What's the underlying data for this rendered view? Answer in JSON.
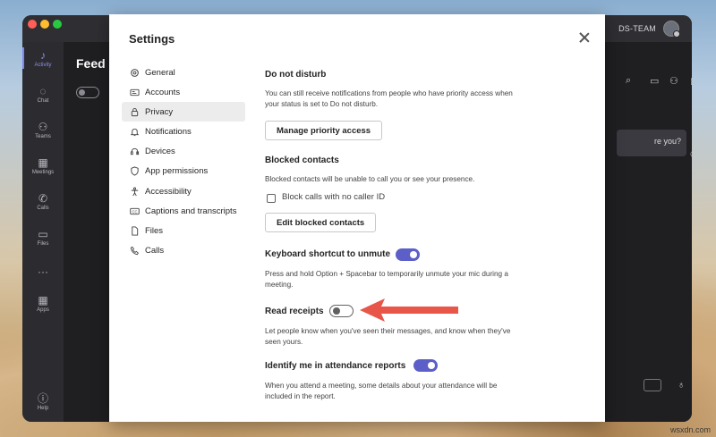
{
  "window": {
    "team_name": "DS-TEAM"
  },
  "rail": [
    {
      "label": "Activity",
      "icon": "bell-icon",
      "glyph": "🔔"
    },
    {
      "label": "Chat",
      "icon": "chat-icon",
      "glyph": "💬"
    },
    {
      "label": "Teams",
      "icon": "teams-icon",
      "glyph": "👥"
    },
    {
      "label": "Meetings",
      "icon": "calendar-icon",
      "glyph": "📅"
    },
    {
      "label": "Calls",
      "icon": "phone-icon",
      "glyph": "📞"
    },
    {
      "label": "Files",
      "icon": "file-icon",
      "glyph": "📄"
    },
    {
      "label": "",
      "icon": "more-icon",
      "glyph": "•••"
    },
    {
      "label": "Apps",
      "icon": "apps-icon",
      "glyph": "▦"
    },
    {
      "label": "Help",
      "icon": "help-icon",
      "glyph": "?"
    }
  ],
  "main": {
    "title": "Feed",
    "bubble_text": "re you?"
  },
  "settings": {
    "title": "Settings",
    "nav": [
      {
        "label": "General",
        "icon": "gear-icon"
      },
      {
        "label": "Accounts",
        "icon": "id-card-icon"
      },
      {
        "label": "Privacy",
        "icon": "lock-icon"
      },
      {
        "label": "Notifications",
        "icon": "bell-icon"
      },
      {
        "label": "Devices",
        "icon": "devices-icon"
      },
      {
        "label": "App permissions",
        "icon": "shield-icon"
      },
      {
        "label": "Accessibility",
        "icon": "accessibility-icon"
      },
      {
        "label": "Captions and transcripts",
        "icon": "cc-icon"
      },
      {
        "label": "Files",
        "icon": "file-icon"
      },
      {
        "label": "Calls",
        "icon": "phone-icon"
      }
    ],
    "selected_nav": "Privacy",
    "dnd": {
      "title": "Do not disturb",
      "text": "You can still receive notifications from people who have priority access when your status is set to Do not disturb.",
      "button": "Manage priority access"
    },
    "blocked": {
      "title": "Blocked contacts",
      "text": "Blocked contacts will be unable to call you or see your presence.",
      "checkbox_label": "Block calls with no caller ID",
      "button": "Edit blocked contacts"
    },
    "shortcut": {
      "title": "Keyboard shortcut to unmute",
      "text": "Press and hold Option + Spacebar to temporarily unmute your mic during a meeting.",
      "enabled": true
    },
    "read_receipts": {
      "title": "Read receipts",
      "text": "Let people know when you've seen their messages, and know when they've seen yours.",
      "enabled": false
    },
    "attendance": {
      "title": "Identify me in attendance reports",
      "text": "When you attend a meeting, some details about your attendance will be included in the report.",
      "enabled": true
    }
  },
  "colors": {
    "accent": "#5b5fc7",
    "arrow": "#e8564a"
  },
  "watermark": "wsxdn.com"
}
